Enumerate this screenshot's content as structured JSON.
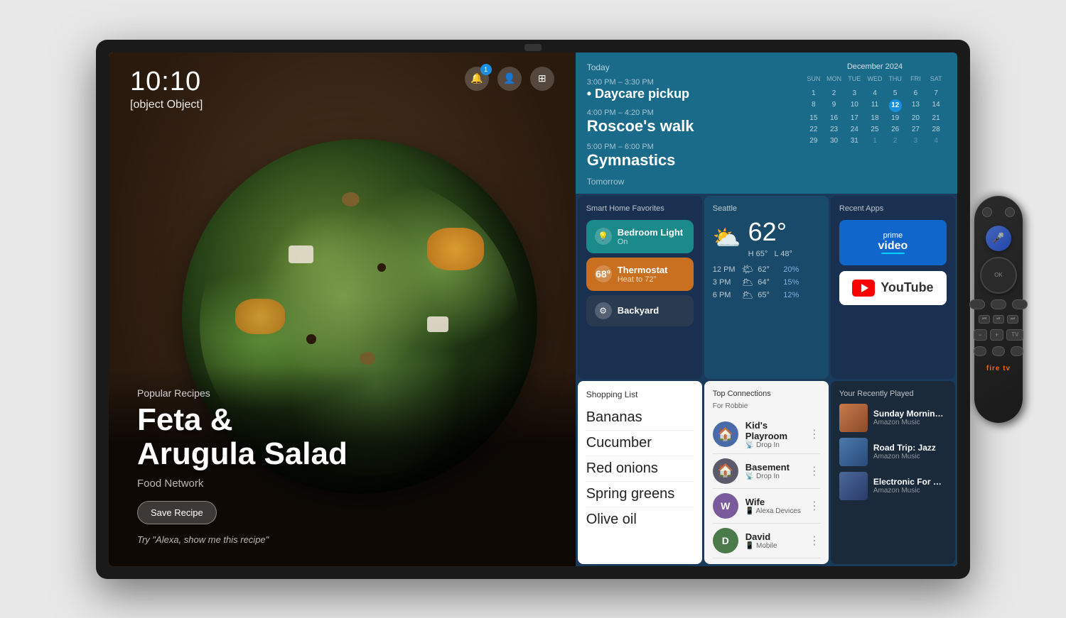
{
  "scene": {
    "bg_color": "#e0e0e0"
  },
  "tv": {
    "time": "10:10",
    "weather": {
      "city": "Seattle",
      "temp": "62°",
      "high": "H 65°",
      "low": "L 48°",
      "forecast": [
        {
          "time": "12 PM",
          "icon": "🌤",
          "temp": "62°",
          "precip": "20%"
        },
        {
          "time": "3 PM",
          "icon": "🌥",
          "temp": "64°",
          "precip": "15%"
        },
        {
          "time": "6 PM",
          "icon": "🌥",
          "temp": "65°",
          "precip": "12%"
        }
      ]
    },
    "left": {
      "recipe_category": "Popular Recipes",
      "recipe_title_line1": "Feta &",
      "recipe_title_line2": "Arugula Salad",
      "recipe_source": "Food Network",
      "save_btn": "Save Recipe",
      "alexa_hint": "Try \"Alexa, show me this recipe\""
    },
    "today": {
      "label": "Today",
      "events": [
        {
          "time": "3:00 PM – 3:30 PM",
          "name": "Daycare pickup"
        },
        {
          "time": "4:00 PM – 4:20 PM",
          "name": "Roscoe's walk"
        },
        {
          "time": "5:00 PM – 6:00 PM",
          "name": "Gymnastics"
        }
      ],
      "tomorrow_label": "Tomorrow"
    },
    "calendar": {
      "month": "December 2024",
      "day_names": [
        "SUN",
        "MON",
        "TUE",
        "WED",
        "THU",
        "FRI",
        "SAT"
      ],
      "today_date": 12,
      "weeks": [
        [
          null,
          null,
          null,
          null,
          null,
          null,
          null
        ],
        [
          1,
          2,
          3,
          4,
          5,
          6,
          7
        ],
        [
          8,
          9,
          10,
          11,
          12,
          13,
          14
        ],
        [
          15,
          16,
          17,
          18,
          19,
          20,
          21
        ],
        [
          22,
          23,
          24,
          25,
          26,
          27,
          28
        ],
        [
          29,
          30,
          31,
          null,
          null,
          null,
          null
        ]
      ]
    },
    "smart_home": {
      "title": "Smart Home Favorites",
      "devices": [
        {
          "name": "Bedroom Light",
          "status": "On",
          "type": "light",
          "color": "teal"
        },
        {
          "name": "Thermostat",
          "status": "Heat to 72°",
          "extra": "68°",
          "type": "thermostat",
          "color": "orange"
        },
        {
          "name": "Backyard",
          "type": "backyard",
          "color": "dark"
        }
      ]
    },
    "recent_apps": {
      "title": "Recent Apps",
      "apps": [
        {
          "name": "Prime Video",
          "type": "prime"
        },
        {
          "name": "YouTube",
          "type": "youtube"
        }
      ]
    },
    "shopping": {
      "title": "Shopping List",
      "items": [
        "Bananas",
        "Cucumber",
        "Red onions",
        "Spring greens",
        "Olive oil"
      ]
    },
    "connections": {
      "title": "Top Connections",
      "subtitle": "For Robbie",
      "items": [
        {
          "name": "Kid's Playroom",
          "status": "Drop In",
          "avatar_letter": "🏠",
          "avatar_bg": "#4a6aaa"
        },
        {
          "name": "Basement",
          "status": "Drop In",
          "avatar_letter": "🏠",
          "avatar_bg": "#4a4a6a"
        },
        {
          "name": "Wife",
          "status": "Alexa Devices",
          "avatar_letter": "W",
          "avatar_bg": "#6a4a8a"
        },
        {
          "name": "David",
          "status": "Mobile",
          "avatar_letter": "D",
          "avatar_bg": "#4a7a4a"
        }
      ]
    },
    "recently_played": {
      "title": "Your Recently Played",
      "items": [
        {
          "title": "Sunday Morning Soul",
          "source": "Amazon Music",
          "bg": "#8a5a3a"
        },
        {
          "title": "Road Trip: Jazz",
          "source": "Amazon Music",
          "bg": "#3a5a7a"
        },
        {
          "title": "Electronic For Work",
          "source": "Amazon Music",
          "bg": "#2a4a6a"
        }
      ]
    }
  }
}
